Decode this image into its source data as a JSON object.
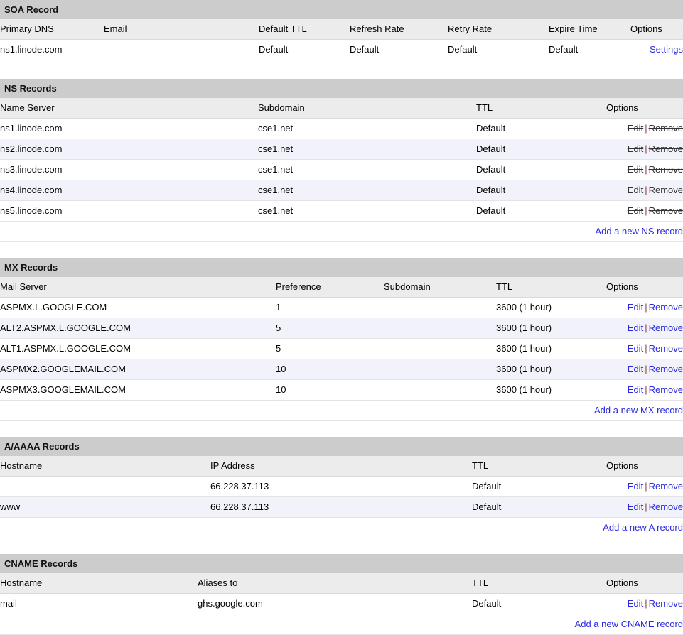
{
  "sections": [
    {
      "id": "soa",
      "title": "SOA Record",
      "columns": [
        "Primary DNS",
        "Email",
        "Default TTL",
        "Refresh Rate",
        "Retry Rate",
        "Expire Time",
        "Options"
      ],
      "rows": [
        {
          "primary_dns": "ns1.linode.com",
          "email": "",
          "default_ttl": "Default",
          "refresh_rate": "Default",
          "retry_rate": "Default",
          "expire_time": "Default",
          "options": {
            "settings": "Settings"
          }
        }
      ],
      "add_link": ""
    },
    {
      "id": "ns",
      "title": "NS Records",
      "columns": [
        "Name Server",
        "Subdomain",
        "TTL",
        "Options"
      ],
      "options_disabled": true,
      "rows": [
        {
          "name_server": "ns1.linode.com",
          "subdomain": "cse1.net",
          "ttl": "Default",
          "edit": "Edit",
          "remove": "Remove"
        },
        {
          "name_server": "ns2.linode.com",
          "subdomain": "cse1.net",
          "ttl": "Default",
          "edit": "Edit",
          "remove": "Remove"
        },
        {
          "name_server": "ns3.linode.com",
          "subdomain": "cse1.net",
          "ttl": "Default",
          "edit": "Edit",
          "remove": "Remove"
        },
        {
          "name_server": "ns4.linode.com",
          "subdomain": "cse1.net",
          "ttl": "Default",
          "edit": "Edit",
          "remove": "Remove"
        },
        {
          "name_server": "ns5.linode.com",
          "subdomain": "cse1.net",
          "ttl": "Default",
          "edit": "Edit",
          "remove": "Remove"
        }
      ],
      "add_link": "Add a new NS record"
    },
    {
      "id": "mx",
      "title": "MX Records",
      "columns": [
        "Mail Server",
        "Preference",
        "Subdomain",
        "TTL",
        "Options"
      ],
      "options_disabled": false,
      "rows": [
        {
          "mail_server": "ASPMX.L.GOOGLE.COM",
          "preference": "1",
          "subdomain": "",
          "ttl": "3600 (1 hour)",
          "edit": "Edit",
          "remove": "Remove"
        },
        {
          "mail_server": "ALT2.ASPMX.L.GOOGLE.COM",
          "preference": "5",
          "subdomain": "",
          "ttl": "3600 (1 hour)",
          "edit": "Edit",
          "remove": "Remove"
        },
        {
          "mail_server": "ALT1.ASPMX.L.GOOGLE.COM",
          "preference": "5",
          "subdomain": "",
          "ttl": "3600 (1 hour)",
          "edit": "Edit",
          "remove": "Remove"
        },
        {
          "mail_server": "ASPMX2.GOOGLEMAIL.COM",
          "preference": "10",
          "subdomain": "",
          "ttl": "3600 (1 hour)",
          "edit": "Edit",
          "remove": "Remove"
        },
        {
          "mail_server": "ASPMX3.GOOGLEMAIL.COM",
          "preference": "10",
          "subdomain": "",
          "ttl": "3600 (1 hour)",
          "edit": "Edit",
          "remove": "Remove"
        }
      ],
      "add_link": "Add a new MX record"
    },
    {
      "id": "a",
      "title": "A/AAAA Records",
      "columns": [
        "Hostname",
        "IP Address",
        "TTL",
        "Options"
      ],
      "options_disabled": false,
      "rows": [
        {
          "hostname": "",
          "ip_address": "66.228.37.113",
          "ttl": "Default",
          "edit": "Edit",
          "remove": "Remove"
        },
        {
          "hostname": "www",
          "ip_address": "66.228.37.113",
          "ttl": "Default",
          "edit": "Edit",
          "remove": "Remove"
        }
      ],
      "add_link": "Add a new A record"
    },
    {
      "id": "cname",
      "title": "CNAME Records",
      "columns": [
        "Hostname",
        "Aliases to",
        "TTL",
        "Options"
      ],
      "options_disabled": false,
      "rows": [
        {
          "hostname": "mail",
          "aliases_to": "ghs.google.com",
          "ttl": "Default",
          "edit": "Edit",
          "remove": "Remove"
        }
      ],
      "add_link": "Add a new CNAME record"
    }
  ],
  "colors": {
    "section_header_bg": "#cccccc",
    "column_header_bg": "#ececec",
    "alt_row_bg": "#f2f2fa",
    "row_bg": "#ffffff",
    "link": "#2a2ae0",
    "separator": "#8a3b3b"
  }
}
